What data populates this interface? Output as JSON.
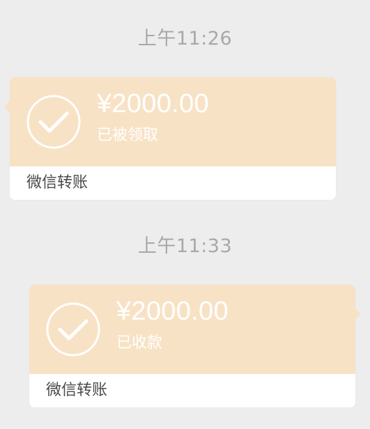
{
  "messages": [
    {
      "timestamp": "上午11:26",
      "amount": "¥2000.00",
      "status": "已被领取",
      "label": "微信转账",
      "side": "left"
    },
    {
      "timestamp": "上午11:33",
      "amount": "¥2000.00",
      "status": "已收款",
      "label": "微信转账",
      "side": "right"
    }
  ],
  "colors": {
    "background": "#ededed",
    "card_accent": "#f8e2c5",
    "card_footer": "#ffffff",
    "timestamp_text": "#a8a8a8",
    "label_text": "#4a4a4a"
  },
  "icons": [
    "check-circle-icon",
    "check-circle-icon"
  ]
}
